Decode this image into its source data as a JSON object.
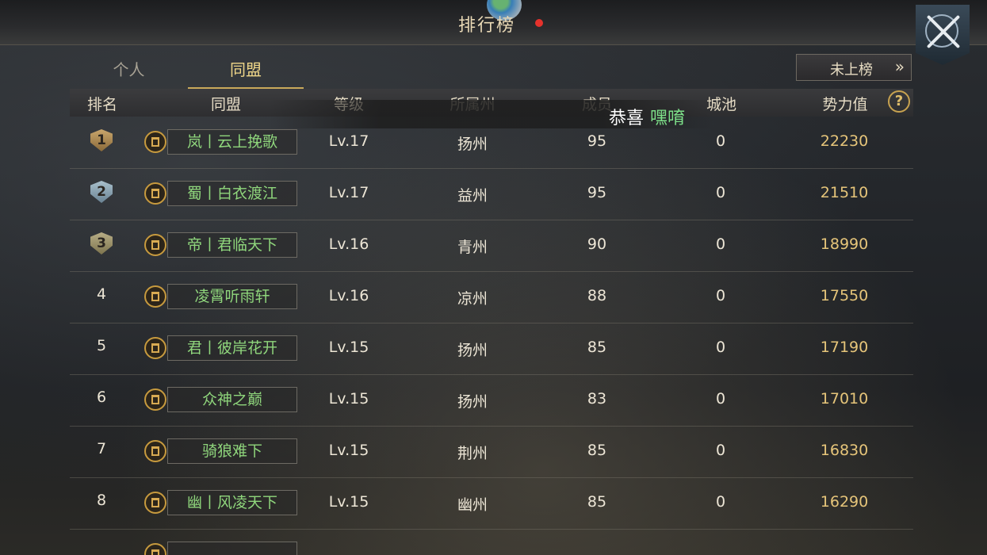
{
  "header": {
    "title": "排行榜"
  },
  "tabs": [
    {
      "label": "个人"
    },
    {
      "label": "同盟"
    }
  ],
  "status_button": {
    "label": "未上榜",
    "arrow": "»"
  },
  "columns": [
    "排名",
    "同盟",
    "等级",
    "所属州",
    "成员",
    "城池",
    "势力值"
  ],
  "help": {
    "label": "?"
  },
  "toast": {
    "prefix": "恭喜",
    "name": "嘿唷"
  },
  "colors": {
    "accent": "#c9a95a",
    "alliance_name": "#8fd67c",
    "power": "#e6c57a",
    "notification": "#e5322c"
  },
  "rows": [
    {
      "rank": "1",
      "name": "岚丨云上挽歌",
      "level": "Lv.17",
      "state": "扬州",
      "members": "95",
      "cities": "0",
      "power": "22230"
    },
    {
      "rank": "2",
      "name": "蜀丨白衣渡江",
      "level": "Lv.17",
      "state": "益州",
      "members": "95",
      "cities": "0",
      "power": "21510"
    },
    {
      "rank": "3",
      "name": "帝丨君临天下",
      "level": "Lv.16",
      "state": "青州",
      "members": "90",
      "cities": "0",
      "power": "18990"
    },
    {
      "rank": "4",
      "name": "凌霄听雨轩",
      "level": "Lv.16",
      "state": "凉州",
      "members": "88",
      "cities": "0",
      "power": "17550"
    },
    {
      "rank": "5",
      "name": "君丨彼岸花开",
      "level": "Lv.15",
      "state": "扬州",
      "members": "85",
      "cities": "0",
      "power": "17190"
    },
    {
      "rank": "6",
      "name": "众神之巅",
      "level": "Lv.15",
      "state": "扬州",
      "members": "83",
      "cities": "0",
      "power": "17010"
    },
    {
      "rank": "7",
      "name": "骑狼难下",
      "level": "Lv.15",
      "state": "荆州",
      "members": "85",
      "cities": "0",
      "power": "16830"
    },
    {
      "rank": "8",
      "name": "幽丨风凌天下",
      "level": "Lv.15",
      "state": "幽州",
      "members": "85",
      "cities": "0",
      "power": "16290"
    }
  ]
}
